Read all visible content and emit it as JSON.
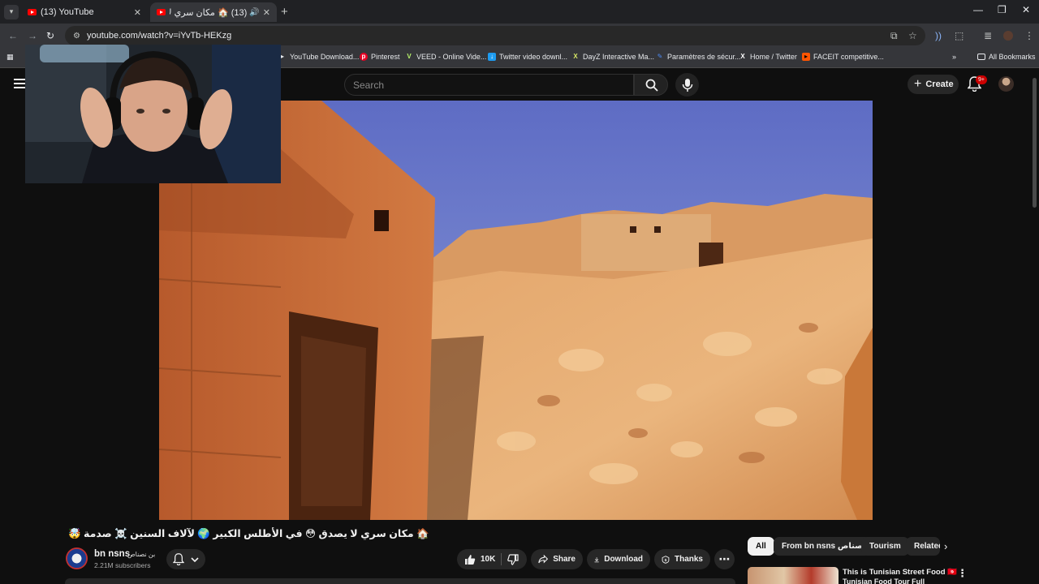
{
  "browser": {
    "tabs": [
      {
        "title": "(13) YouTube",
        "active": false
      },
      {
        "title": "(13) 🏠 مكان سري لا يصدق 😳",
        "active": true
      }
    ],
    "url": "youtube.com/watch?v=iYvTb-HEKzg",
    "bookmarks": [
      {
        "label": "YouTube Download...",
        "icon": "download-icon",
        "color": "#e8eaed"
      },
      {
        "label": "Pinterest",
        "icon": "pinterest-icon",
        "color": "#e60023"
      },
      {
        "label": "VEED - Online Vide...",
        "icon": "veed-icon",
        "color": "#b7f26b"
      },
      {
        "label": "Twitter video downl...",
        "icon": "twitter-downloader-icon",
        "color": "#1d9bf0"
      },
      {
        "label": "DayZ Interactive Ma...",
        "icon": "dayz-icon",
        "color": "#d7e866"
      },
      {
        "label": "Paramètres de sécur...",
        "icon": "settings-icon",
        "color": "#4c8bf5"
      },
      {
        "label": "Home / Twitter",
        "icon": "x-icon",
        "color": "#ffffff"
      },
      {
        "label": "FACEIT competitive...",
        "icon": "faceit-icon",
        "color": "#ff5500"
      }
    ],
    "all_bookmarks": "All Bookmarks"
  },
  "youtube": {
    "search_placeholder": "Search",
    "create_label": "Create",
    "notification_count": "9+",
    "video": {
      "title": "🏠 مكان سري لا يصدق 😳 في الأطلس الكبير 🌍 لآلاف السنين ☠️ صدمة 🤯",
      "channel": "bn nsns",
      "channel_alt": "بن نصناص",
      "subscribers": "2.21M subscribers",
      "likes": "10K",
      "share_label": "Share",
      "download_label": "Download",
      "thanks_label": "Thanks"
    },
    "chips": [
      "All",
      "From bn nsns بن نصناص",
      "Tourism",
      "Related"
    ],
    "recommendation": {
      "title": "This is Tunisian Street Food 🇹🇳",
      "subtitle": "Tunisian Food Tour Full"
    }
  },
  "colors": {
    "background": "#0f0f0f",
    "chip": "#272727",
    "accent_red": "#ff0000",
    "sky": "#6b7fc9"
  }
}
